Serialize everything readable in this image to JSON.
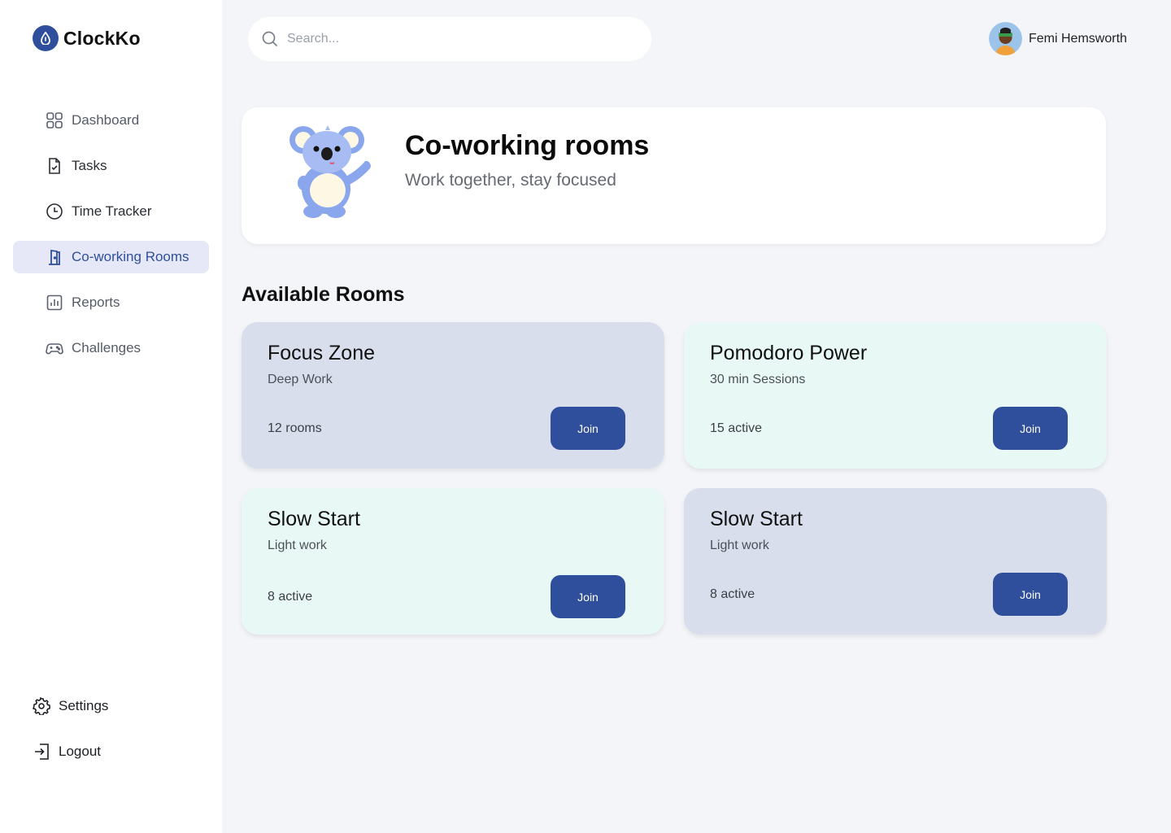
{
  "app": {
    "name": "ClockKo"
  },
  "sidebar": {
    "items": [
      {
        "label": "Dashboard",
        "icon": "grid-icon"
      },
      {
        "label": "Tasks",
        "icon": "task-file-icon"
      },
      {
        "label": "Time Tracker",
        "icon": "clock-icon"
      },
      {
        "label": "Co-working Rooms",
        "icon": "door-icon",
        "active": true
      },
      {
        "label": "Reports",
        "icon": "chart-icon"
      },
      {
        "label": "Challenges",
        "icon": "gamepad-icon"
      }
    ],
    "bottom": [
      {
        "label": "Settings",
        "icon": "gear-icon"
      },
      {
        "label": "Logout",
        "icon": "logout-icon"
      }
    ]
  },
  "search": {
    "placeholder": "Search..."
  },
  "user": {
    "name": "Femi Hemsworth"
  },
  "hero": {
    "title": "Co-working rooms",
    "subtitle": "Work together, stay focused"
  },
  "rooms_section": {
    "title": "Available Rooms"
  },
  "rooms": [
    {
      "title": "Focus Zone",
      "subtitle": "Deep Work",
      "meta": "12 rooms",
      "button": "Join"
    },
    {
      "title": "Pomodoro Power",
      "subtitle": "30 min Sessions",
      "meta": "15 active",
      "button": "Join"
    },
    {
      "title": "Slow Start",
      "subtitle": "Light work",
      "meta": "8 active",
      "button": "Join"
    },
    {
      "title": "Slow Start",
      "subtitle": "Light work",
      "meta": "8 active",
      "button": "Join"
    }
  ],
  "colors": {
    "accent": "#2f4f9c",
    "card_blue": "#d9deec",
    "card_mint": "#e8f9f5",
    "active_nav_bg": "#e6e8f7"
  }
}
